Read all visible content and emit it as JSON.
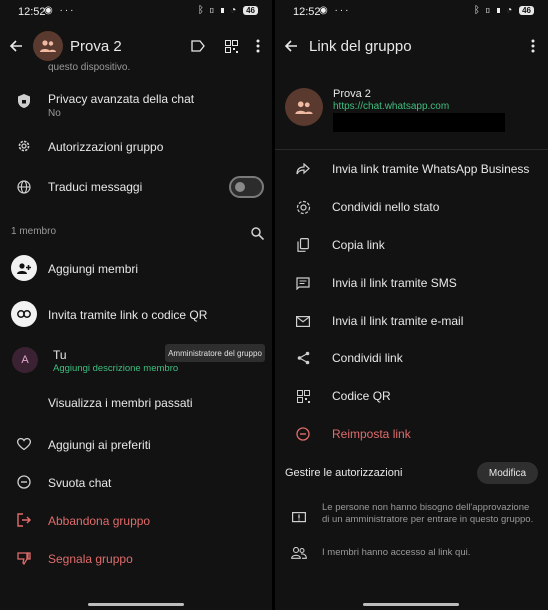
{
  "status_bar": {
    "time": "12:52",
    "battery": "46",
    "left_icons": [
      "telegram-icon",
      "more-dots-icon"
    ],
    "right_icons": [
      "bluetooth-icon",
      "vibrate-icon",
      "signal-icon",
      "wifi-icon"
    ]
  },
  "left": {
    "header": {
      "title": "Prova 2"
    },
    "cut_text": "questo dispositivo.",
    "privacy": {
      "title": "Privacy avanzata della chat",
      "value": "No"
    },
    "permissions": {
      "label": "Autorizzazioni gruppo"
    },
    "translate": {
      "label": "Traduci messaggi",
      "enabled": false
    },
    "members": {
      "count_label": "1 membro",
      "add_label": "Aggiungi membri",
      "invite_label": "Invita tramite link o codice QR",
      "member": {
        "initial": "A",
        "name": "Tu",
        "desc": "Aggiungi descrizione membro",
        "role": "Amministratore del gruppo"
      },
      "past_members_label": "Visualizza i membri passati"
    },
    "actions": {
      "favorites": "Aggiungi ai preferiti",
      "clear_chat": "Svuota chat",
      "leave_group": "Abbandona gruppo",
      "report_group": "Segnala gruppo"
    }
  },
  "right": {
    "header": {
      "title": "Link del gruppo"
    },
    "group": {
      "name": "Prova 2",
      "link": "https://chat.whatsapp.com"
    },
    "menu": [
      {
        "label": "Invia link tramite WhatsApp Business",
        "icon": "share-forward-icon"
      },
      {
        "label": "Condividi nello stato",
        "icon": "status-icon"
      },
      {
        "label": "Copia link",
        "icon": "copy-icon"
      },
      {
        "label": "Invia il link tramite SMS",
        "icon": "sms-icon"
      },
      {
        "label": "Invia il link tramite e-mail",
        "icon": "email-icon"
      },
      {
        "label": "Condividi link",
        "icon": "share-icon"
      },
      {
        "label": "Codice QR",
        "icon": "qr-code-icon"
      },
      {
        "label": "Reimposta link",
        "icon": "reset-icon"
      }
    ],
    "permissions": {
      "title": "Gestire le autorizzazioni",
      "button": "Modifica",
      "approval_text": "Le persone non hanno bisogno dell'approvazione di un amministratore per entrare in questo gruppo.",
      "access_text": "I membri hanno accesso al link qui."
    }
  },
  "colors": {
    "background": "#121212",
    "danger": "#e06b6b",
    "link": "#3fbf7f",
    "group_avatar": "#5a3a2e"
  }
}
